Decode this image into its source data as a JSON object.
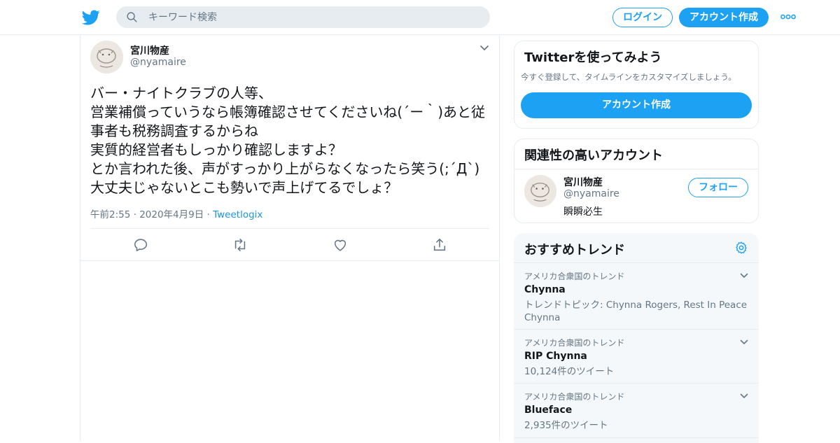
{
  "header": {
    "search_placeholder": "キーワード検索",
    "login_label": "ログイン",
    "signup_label": "アカウント作成"
  },
  "tweet": {
    "author_name": "宮川物産",
    "author_handle": "@nyamaire",
    "text": "バー・ナイトクラブの人等、\n営業補償っていうなら帳簿確認させてくださいね(´ー｀)あと従事者も税務調査するからね\n実質的経営者もしっかり確認しますよ？\nとか言われた後、声がすっかり上がらなくなったら笑う(;´Д`)大丈夫じゃないとこも勢いで声上げてるでしょ？",
    "timestamp": "午前2:55 · 2020年4月9日",
    "separator": "·",
    "source": "Tweetlogix"
  },
  "signup_card": {
    "title": "Twitterを使ってみよう",
    "subtitle": "今すぐ登録して、タイムラインをカスタマイズしましょう。",
    "button_label": "アカウント作成"
  },
  "related": {
    "title": "関連性の高いアカウント",
    "name": "宮川物産",
    "handle": "@nyamaire",
    "bio": "瞬瞬必生",
    "follow_label": "フォロー"
  },
  "trends": {
    "title": "おすすめトレンド",
    "items": [
      {
        "context": "アメリカ合衆国のトレンド",
        "name": "Chynna",
        "desc": "トレンドトピック: Chynna Rogers, Rest In Peace Chynna"
      },
      {
        "context": "アメリカ合衆国のトレンド",
        "name": "RIP Chynna",
        "desc": "10,124件のツイート"
      },
      {
        "context": "アメリカ合衆国のトレンド",
        "name": "Blueface",
        "desc": "2,935件のツイート"
      }
    ]
  },
  "colors": {
    "accent": "#1da1f2",
    "muted_text": "#657786",
    "border": "#e6ecf0",
    "panel_bg": "#f5f8fa"
  },
  "icons": [
    "twitter-bird-icon",
    "search-icon",
    "more-dots-icon",
    "chevron-down-icon",
    "reply-icon",
    "retweet-icon",
    "like-icon",
    "share-icon",
    "gear-icon"
  ]
}
